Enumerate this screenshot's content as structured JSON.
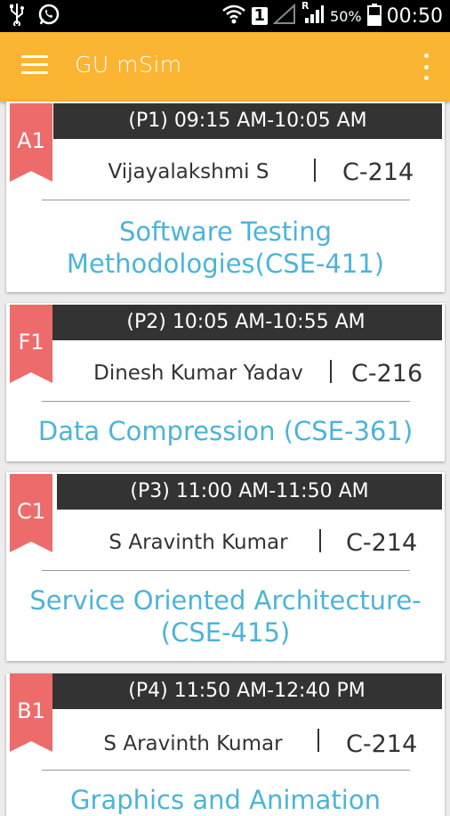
{
  "status_bar": {
    "network_badge": "1",
    "roaming": "R",
    "battery": "50%",
    "time": "00:50"
  },
  "app_bar": {
    "title": "GU mSim"
  },
  "classes": [
    {
      "code": "A1",
      "period": "(P1) 09:15 AM-10:05 AM",
      "faculty": "Vijayalakshmi S",
      "room": "C-214",
      "subject": "Software Testing Methodologies(CSE-411)"
    },
    {
      "code": "F1",
      "period": "(P2) 10:05 AM-10:55 AM",
      "faculty": "Dinesh Kumar Yadav",
      "room": "C-216",
      "subject": "Data Compression (CSE-361)"
    },
    {
      "code": "C1",
      "period": "(P3) 11:00 AM-11:50 AM",
      "faculty": "S Aravinth Kumar",
      "room": "C-214",
      "subject": "Service Oriented Architecture-(CSE-415)"
    },
    {
      "code": "B1",
      "period": "(P4) 11:50 AM-12:40 PM",
      "faculty": "S Aravinth Kumar",
      "room": "C-214",
      "subject": "Graphics and Animation"
    }
  ],
  "colors": {
    "app_bar": "#fbb532",
    "period_bar": "#333333",
    "ribbon": "#ee6b6b",
    "subject_text": "#4cb4d8"
  }
}
